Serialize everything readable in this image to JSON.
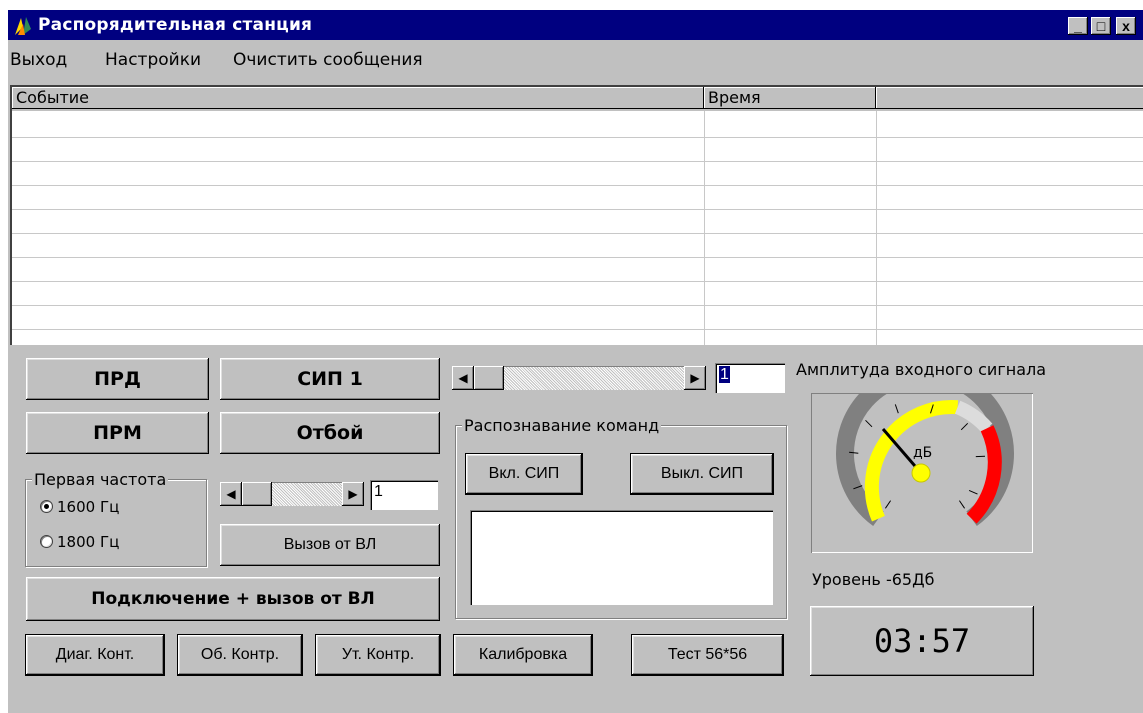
{
  "window": {
    "title": "Распорядительная станция",
    "controls": {
      "minimize": "_",
      "maximize": "□",
      "close": "x"
    }
  },
  "menu": [
    "Выход",
    "Настройки",
    "Очистить сообщения"
  ],
  "event_list": {
    "columns": [
      "Событие",
      "Время",
      ""
    ],
    "rows": []
  },
  "buttons": {
    "prd": "ПРД",
    "prm": "ПРМ",
    "sip1": "СИП 1",
    "otboy": "Отбой",
    "call_from_vl": "Вызов от ВЛ",
    "connect_call": "Подключение + вызов от ВЛ",
    "diag": "Диаг. Конт.",
    "ob_control": "Об. Контр.",
    "ut_control": "Ут. Контр.",
    "calibration": "Калибровка",
    "test": "Тест 56*56",
    "sip_on": "Вкл. СИП",
    "sip_off": "Выкл. СИП"
  },
  "top_scroll": {
    "value": "1"
  },
  "freq_scroll": {
    "value": "1"
  },
  "first_freq": {
    "label": "Первая частота",
    "options": [
      {
        "label": "1600 Гц",
        "checked": true
      },
      {
        "label": "1800 Гц",
        "checked": false
      }
    ]
  },
  "recognition": {
    "label": "Распознавание команд"
  },
  "amplitude": {
    "label": "Амплитуда входного сигнала",
    "unit": "дБ",
    "level_text": "Уровень -65Дб",
    "colors": {
      "yellow": "#ffff00",
      "grey": "#dcdcdc",
      "red": "#ff0000"
    }
  },
  "timer": {
    "value": "03:57"
  },
  "colors": {
    "face": "#c0c0c0",
    "title_bar": "#000080"
  }
}
